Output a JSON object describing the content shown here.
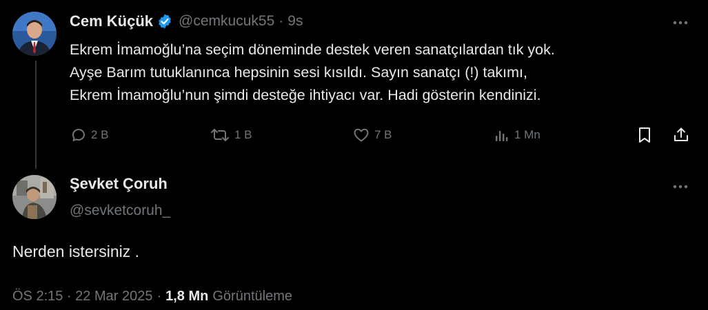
{
  "parent_tweet": {
    "display_name": "Cem Küçük",
    "handle": "@cemkucuk55",
    "separator": "·",
    "time": "9s",
    "verified_icon": "verified-badge-icon",
    "text_lines": [
      "Ekrem İmamoğlu’na seçim döneminde destek veren sanatçılardan tık yok.",
      "Ayşe Barım tutuklanınca hepsinin sesi kısıldı. Sayın sanatçı (!)  takımı,",
      "Ekrem İmamoğlu’nun şimdi desteğe ihtiyacı var. Hadi gösterin kendinizi."
    ],
    "actions": {
      "reply_count": "2 B",
      "retweet_count": "1 B",
      "like_count": "7 B",
      "views_count": "1 Mn"
    }
  },
  "reply_tweet": {
    "display_name": "Şevket Çoruh",
    "handle": "@sevketcoruh_",
    "text": "Nerden istersiniz .",
    "timestamp": "ÖS 2:15 · 22 Mar 2025",
    "separator": "·",
    "views_value": "1,8 Mn",
    "views_label": "Görüntüleme"
  },
  "colors": {
    "background": "#000000",
    "primary_text": "#e7e9ea",
    "secondary_text": "#71767b",
    "verified_blue": "#1d9bf0",
    "thread_line": "#333639"
  }
}
